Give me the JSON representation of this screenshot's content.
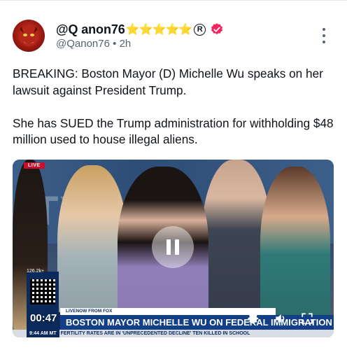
{
  "post": {
    "display_name": "@Q anon76",
    "stars": "⭐⭐⭐⭐⭐",
    "registered_mark": "R",
    "handle": "@Qanon76",
    "separator": "•",
    "time": "2h",
    "text_line1": "BREAKING: Boston Mayor (D) Michelle Wu speaks on her lawsuit against President Trump.",
    "text_line2": "She has SUED the Trump administration for withholding $48 million used to house illegal aliens.",
    "colors": {
      "verified": "#f4245e",
      "star": "#f5b817",
      "muted": "#536471"
    },
    "icons": [
      "avatar",
      "star-icon",
      "registered-icon",
      "verified-badge-icon",
      "more-options-icon"
    ]
  },
  "video": {
    "elapsed": "00:47",
    "live_tag": "LIVE",
    "viewer_count": "126.2k+",
    "source_tag": "LIVENOW FROM FOX",
    "headline": "BOSTON MAYOR MICHELLE WU ON FEDERAL IMMIGRATION POLICIES",
    "crawl_time": "9:44 AM MT",
    "crawl_text": "FERTILITY RATES ARE IN 'UNPRECEDENTED DECLINE'   TEN KILLED IN SCHOOL",
    "state": "paused",
    "icons": [
      "pause-icon",
      "settings-icon",
      "volume-icon",
      "fullscreen-icon"
    ]
  }
}
